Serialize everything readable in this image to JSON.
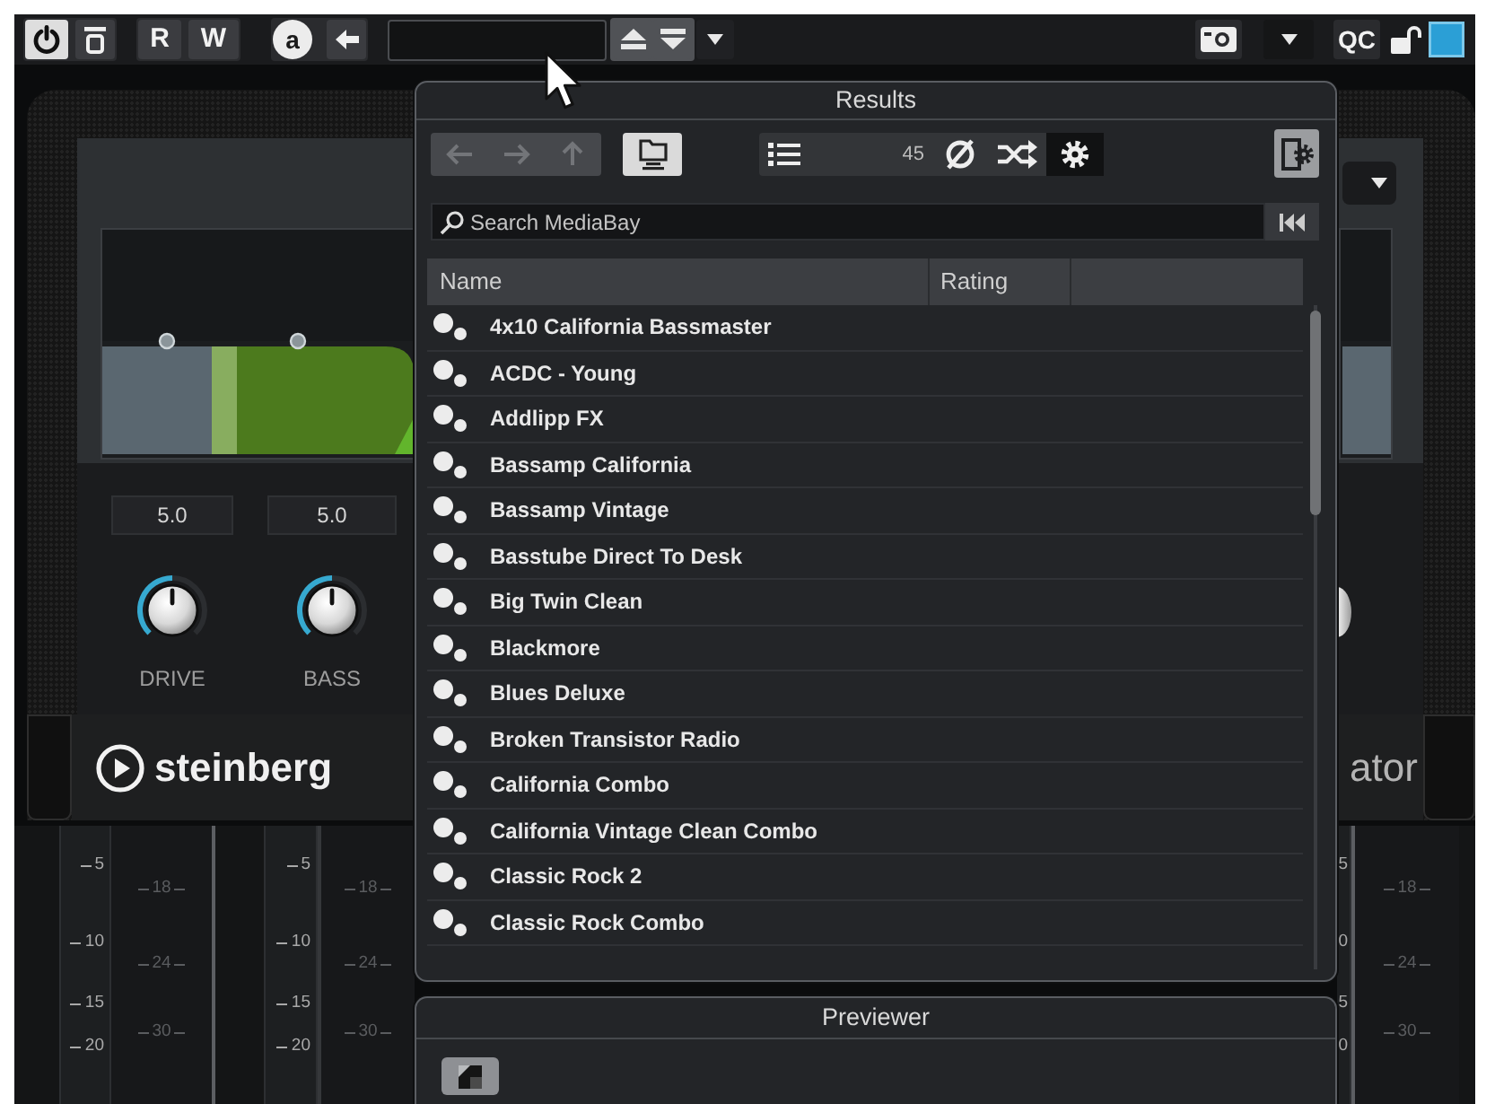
{
  "toolbar": {
    "power": {
      "on": true
    },
    "read_label": "R",
    "write_label": "W",
    "circled_label": "a",
    "qc_label": "QC"
  },
  "plugin": {
    "controls": [
      {
        "reading": "5.0",
        "label": "DRIVE",
        "level": 0.5
      },
      {
        "reading": "5.0",
        "label": "BASS",
        "level": 0.5
      }
    ],
    "brand": "steinberg",
    "plugin_title": "ator"
  },
  "meters": {
    "left": [
      {
        "kind": "major",
        "labels": [
          "5",
          "10",
          "15",
          "20"
        ]
      },
      {
        "kind": "minor",
        "labels": [
          "18",
          "24",
          "30"
        ]
      },
      {
        "kind": "major",
        "labels": [
          "5",
          "10",
          "15",
          "20"
        ]
      },
      {
        "kind": "minor",
        "labels": [
          "18",
          "24",
          "30"
        ]
      }
    ],
    "right": [
      {
        "kind": "major",
        "labels": [
          "5",
          "0",
          "5",
          "0"
        ]
      },
      {
        "kind": "minor",
        "labels": [
          "18",
          "24",
          "30"
        ]
      }
    ]
  },
  "results": {
    "title": "Results",
    "nav_buttons": [
      {
        "disabled": true
      },
      {
        "disabled": true
      },
      {
        "disabled": true
      }
    ],
    "folder_button": {
      "on": true
    },
    "count": "45",
    "search": {
      "placeholder": "Search MediaBay"
    },
    "columns": [
      "Name",
      "Rating"
    ],
    "rows": [
      {
        "name": "4x10 California Bassmaster"
      },
      {
        "name": "ACDC - Young"
      },
      {
        "name": "Addlipp FX"
      },
      {
        "name": "Bassamp California"
      },
      {
        "name": "Bassamp Vintage"
      },
      {
        "name": "Basstube Direct To Desk"
      },
      {
        "name": "Big Twin Clean"
      },
      {
        "name": "Blackmore"
      },
      {
        "name": "Blues Deluxe"
      },
      {
        "name": "Broken Transistor Radio"
      },
      {
        "name": "California Combo"
      },
      {
        "name": "California Vintage Clean Combo"
      },
      {
        "name": "Classic Rock 2"
      },
      {
        "name": "Classic Rock Combo"
      }
    ]
  },
  "previewer": {
    "title": "Previewer"
  }
}
